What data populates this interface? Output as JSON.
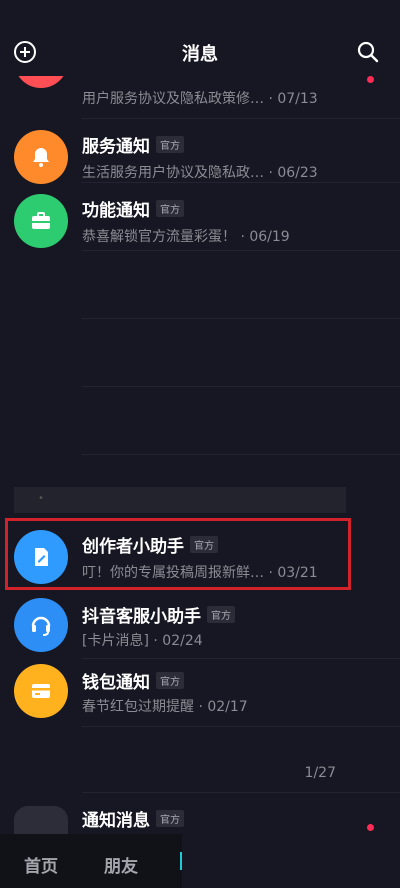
{
  "header": {
    "title": "消息"
  },
  "badge_label": "官方",
  "messages": [
    {
      "name": "",
      "preview": "用户服务协议及隐私政策修…",
      "date": "· 07/13",
      "color": "#ff4f54"
    },
    {
      "name": "服务通知",
      "preview": "生活服务用户协议及隐私政…",
      "date": "· 06/23",
      "color": "#ff8a2b",
      "icon": "bell-icon"
    },
    {
      "name": "功能通知",
      "preview": "恭喜解锁官方流量彩蛋！",
      "date": "· 06/19",
      "color": "#2ecc71",
      "icon": "briefcase-icon"
    },
    {
      "name": "创作者小助手",
      "preview": "叮！你的专属投稿周报新鲜…",
      "date": "· 03/21",
      "color": "#2f9bff",
      "icon": "edit-icon"
    },
    {
      "name": "抖音客服小助手",
      "preview": "[卡片消息]",
      "date": "· 02/24",
      "color": "#2d8ff5",
      "icon": "headset-icon"
    },
    {
      "name": "钱包通知",
      "preview": "春节红包过期提醒",
      "date": "· 02/17",
      "color": "#ffb21e",
      "icon": "card-icon"
    },
    {
      "name": "通知消息",
      "preview": "",
      "date": "",
      "color": "#2c2d38"
    }
  ],
  "page_count": "1/27",
  "tabs": {
    "home": "首页",
    "friends": "朋友"
  }
}
